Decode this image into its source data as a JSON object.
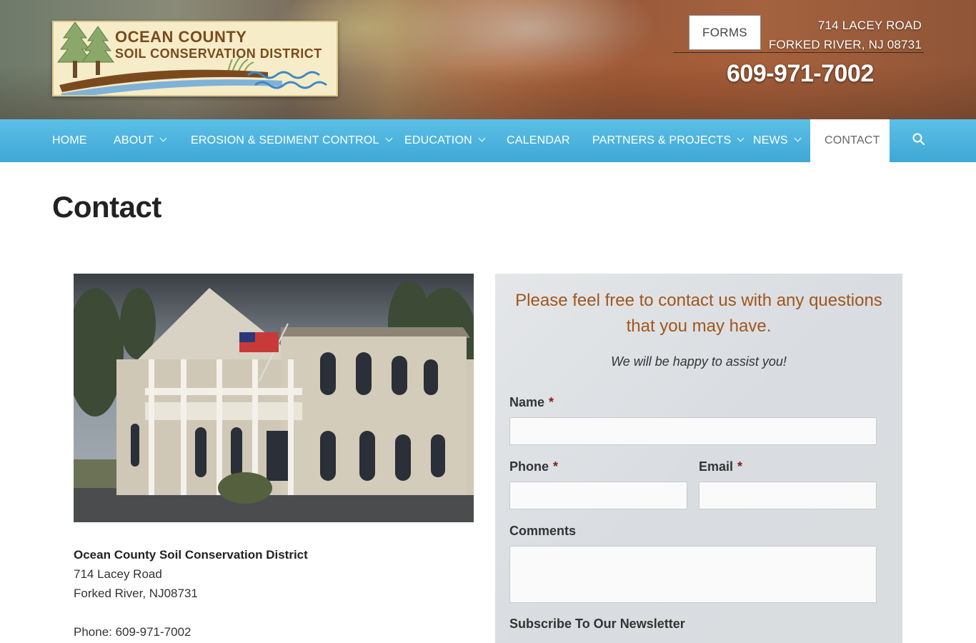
{
  "header": {
    "logo": {
      "line1": "OCEAN COUNTY",
      "line2": "SOIL CONSERVATION DISTRICT"
    },
    "forms_button": "FORMS",
    "address_line1": "714 LACEY ROAD",
    "address_line2": "FORKED RIVER, NJ 08731",
    "phone": "609-971-7002"
  },
  "nav": {
    "items": [
      {
        "label": "HOME",
        "has_dropdown": false
      },
      {
        "label": "ABOUT",
        "has_dropdown": true
      },
      {
        "label": "EROSION & SEDIMENT CONTROL",
        "has_dropdown": true
      },
      {
        "label": "EDUCATION",
        "has_dropdown": true
      },
      {
        "label": "CALENDAR",
        "has_dropdown": false
      },
      {
        "label": "PARTNERS & PROJECTS",
        "has_dropdown": true
      },
      {
        "label": "NEWS",
        "has_dropdown": true
      },
      {
        "label": "CONTACT",
        "has_dropdown": false,
        "active": true
      }
    ],
    "search_icon": "search-icon",
    "color": "#4bb3df"
  },
  "page": {
    "title": "Contact"
  },
  "office": {
    "name": "Ocean County Soil Conservation District",
    "street": "714 Lacey Road",
    "city": "Forked River, NJ08731",
    "phone": "Phone: 609-971-7002"
  },
  "form": {
    "heading": "Please feel free to contact us with any questions that you may have.",
    "subheading": "We will be happy to assist you!",
    "required_marker": "*",
    "name_label": "Name",
    "phone_label": "Phone",
    "email_label": "Email",
    "comments_label": "Comments",
    "newsletter_label": "Subscribe To Our Newsletter",
    "name_value": "",
    "phone_value": "",
    "email_value": "",
    "comments_value": "",
    "heading_color": "#a0561c"
  }
}
